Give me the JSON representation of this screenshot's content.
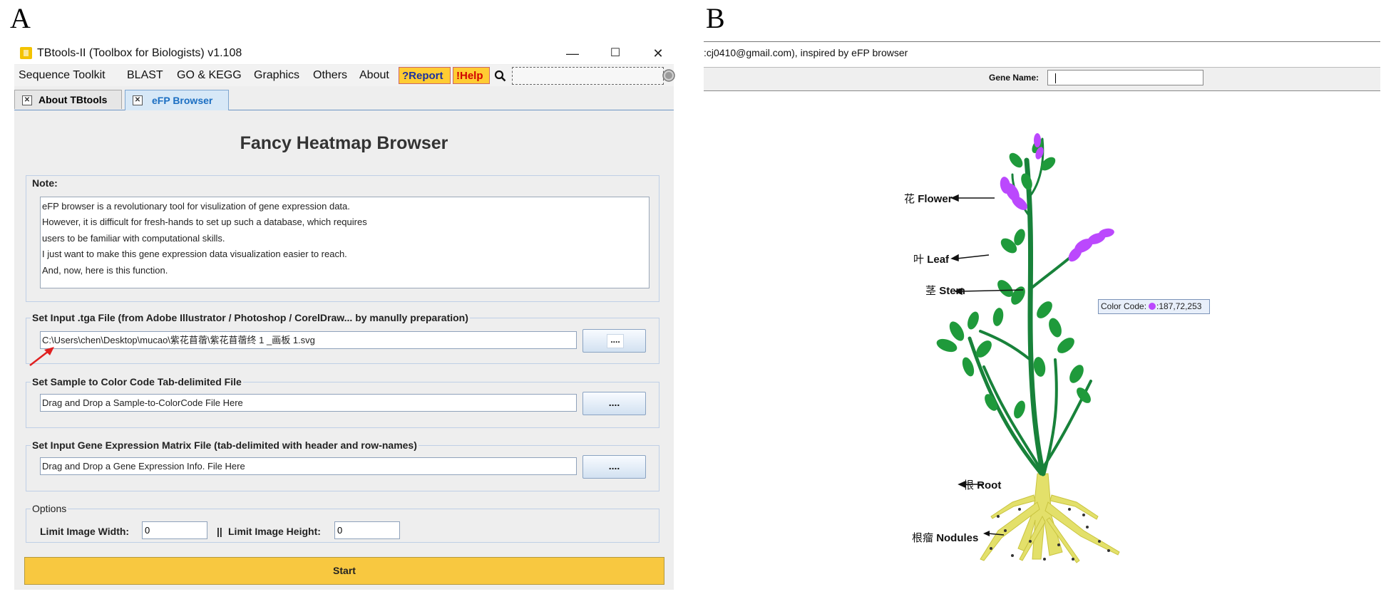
{
  "panels": {
    "a": "A",
    "b": "B"
  },
  "window": {
    "title": "TBtools-II (Toolbox for Biologists) v1.108",
    "controls": {
      "minimize": "—",
      "maximize": "☐",
      "close": "✕"
    }
  },
  "menu": {
    "items": [
      "Sequence Toolkit",
      "BLAST",
      "GO & KEGG",
      "Graphics",
      "Others",
      "About"
    ],
    "report": "?Report",
    "help": "!Help"
  },
  "tabs": [
    {
      "label": "About TBtools",
      "active": false
    },
    {
      "label": "eFP Browser",
      "active": true
    }
  ],
  "page_title": "Fancy Heatmap Browser",
  "note": {
    "label": "Note:",
    "lines": [
      "eFP browser is a revolutionary tool for visulization of gene expression data.",
      "However, it is difficult for fresh-hands to set up such a database, which requires",
      "users to be familiar with computational skills.",
      "I just want to make this gene expression data visualization easier to reach.",
      "And, now, here is this function."
    ]
  },
  "inputs": {
    "tga": {
      "label": "Set Input .tga File (from Adobe Illustrator / Photoshop / CorelDraw... by manully preparation)",
      "value": "C:\\Users\\chen\\Desktop\\mucao\\紫花苜蓿\\紫花苜蓿终 1 _画板 1.svg",
      "button": "...."
    },
    "sample": {
      "label": "Set Sample to Color Code Tab-delimited File",
      "value": "Drag and Drop a Sample-to-ColorCode File Here",
      "button": "...."
    },
    "matrix": {
      "label": "Set Input Gene Expression Matrix File (tab-delimited with header and row-names)",
      "value": "Drag and Drop a Gene Expression Info. File Here",
      "button": "...."
    }
  },
  "options": {
    "label": "Options",
    "width_label": "Limit Image Width:",
    "width_value": "0",
    "separator": "||",
    "height_label": "Limit Image Height:",
    "height_value": "0"
  },
  "start_button": "Start",
  "browser": {
    "credit": ":cj0410@gmail.com), inspired by eFP browser",
    "gene_name_label": "Gene Name:",
    "gene_name_value": "",
    "color_code_label": "Color Code:",
    "color_code_value": ":187,72,253",
    "color_code_color": "#bb48fd",
    "labels": {
      "flower": {
        "zh": "花",
        "en": "Flower"
      },
      "leaf": {
        "zh": "叶",
        "en": "Leaf"
      },
      "stem": {
        "zh": "茎",
        "en": "Stem"
      },
      "root": {
        "zh": "根",
        "en": "Root"
      },
      "nodules": {
        "zh": "根瘤",
        "en": "Nodules"
      }
    }
  },
  "colors": {
    "flower": "#bb48fd",
    "leaf": "#1f9a3b",
    "stem": "#18823a",
    "root": "#e3e06a",
    "start_button": "#f8c840",
    "arrow": "#e02020"
  },
  "icons": {
    "app": "tbtools-logo-icon",
    "search": "search-icon",
    "tab_close": "tab-close-icon",
    "spinner": "loading-icon",
    "pointer": "red-arrow-icon"
  }
}
